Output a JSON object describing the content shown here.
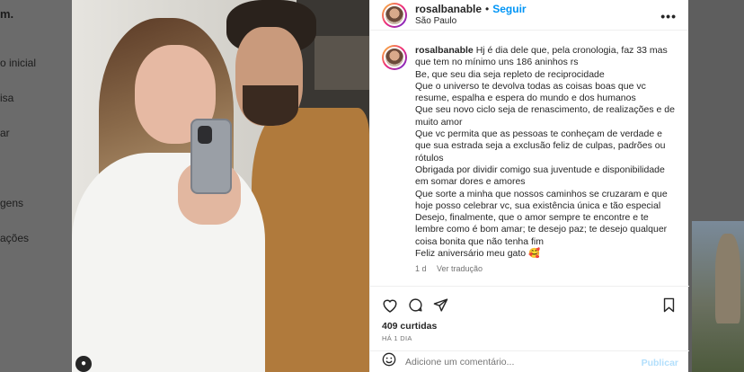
{
  "sidebar": {
    "logo": "m.",
    "items": [
      {
        "label": "o inicial"
      },
      {
        "label": "isa"
      },
      {
        "label": "ar"
      },
      {
        "label": "gens"
      },
      {
        "label": "ações"
      }
    ]
  },
  "post": {
    "username": "rosalbanable",
    "follow_label": "Seguir",
    "location": "São Paulo",
    "caption_lines": [
      "Hj é dia dele que, pela cronologia, faz 33 mas que tem no mínimo uns 186 aninhos rs",
      "Be, que seu dia seja repleto de reciprocidade",
      "Que o universo te devolva todas as coisas boas que vc resume, espalha e espera do mundo e dos humanos",
      "Que seu novo ciclo seja de renascimento, de realizações e de muito amor",
      "Que vc permita que as pessoas te conheçam de verdade e que sua estrada seja a exclusão feliz de culpas, padrões ou rótulos",
      "Obrigada por dividir comigo sua juventude e disponibilidade em somar dores e amores",
      "Que sorte a minha que nossos caminhos se cruzaram e que hoje posso celebrar vc, sua existência única e tão especial",
      "Desejo, finalmente, que o amor sempre te encontre e te lembre como é bom amar; te desejo paz; te desejo qualquer coisa bonita que não tenha fim",
      "Feliz aniversário meu gato 🥰"
    ],
    "time_short": "1 d",
    "translate_label": "Ver tradução",
    "likes": "409 curtidas",
    "time_ago": "HÁ 1 DIA",
    "comment_placeholder": "Adicione um comentário...",
    "publish_label": "Publicar"
  },
  "colors": {
    "accent": "#0095f6",
    "publish_disabled": "#b2dffc"
  },
  "icons": [
    "more-icon",
    "heart-icon",
    "comment-icon",
    "share-icon",
    "bookmark-icon",
    "emoji-icon",
    "user-tag-icon"
  ]
}
